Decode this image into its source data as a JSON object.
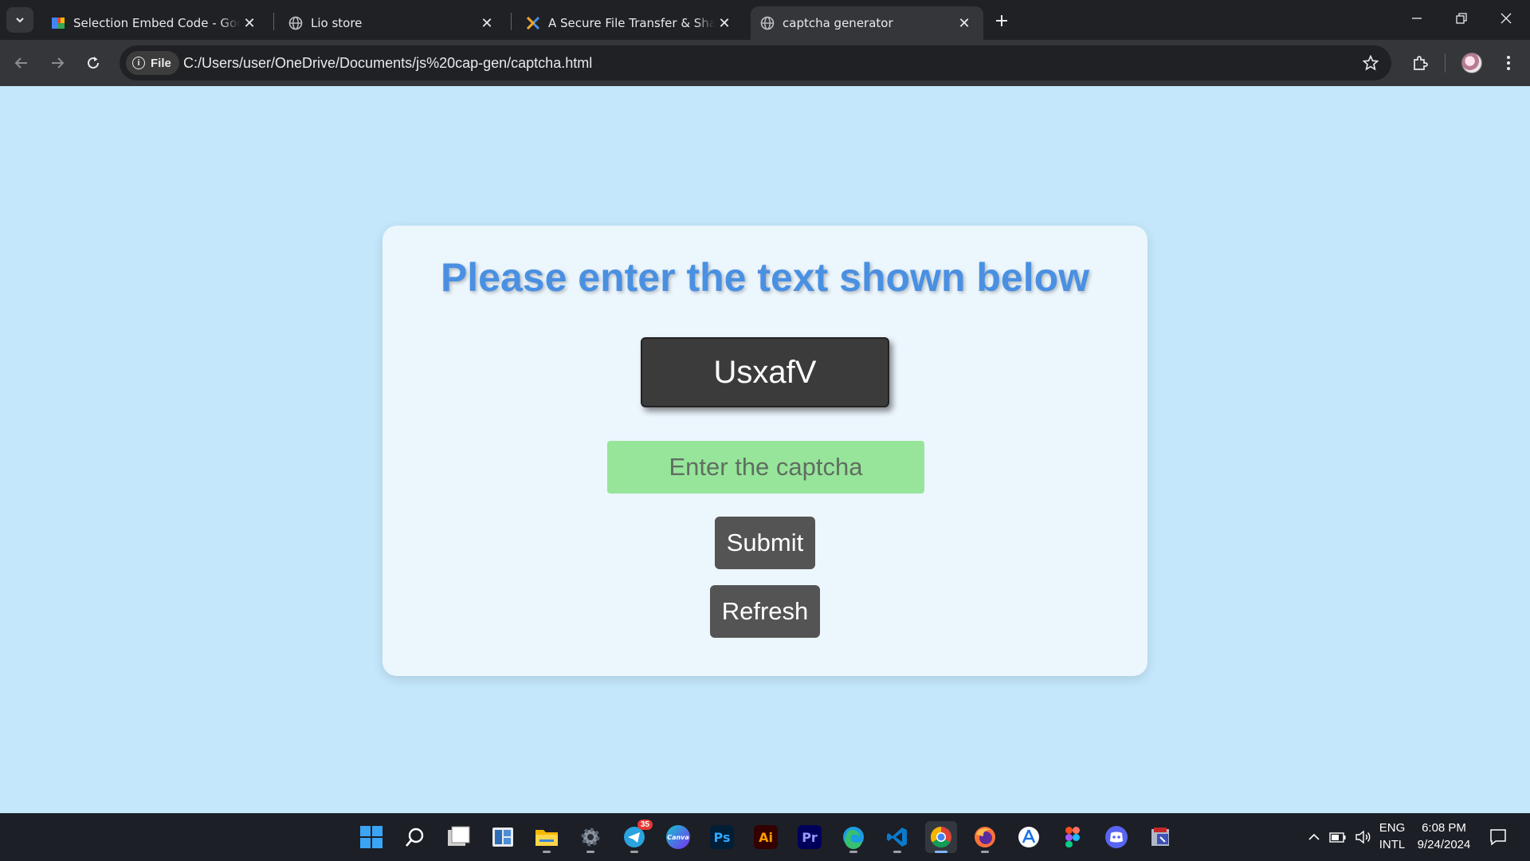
{
  "browser": {
    "tabs": [
      {
        "title": "Selection Embed Code - Google",
        "active": false
      },
      {
        "title": "Lio store",
        "active": false
      },
      {
        "title": "A Secure File Transfer & Share A",
        "active": false
      },
      {
        "title": "captcha generator",
        "active": true
      }
    ],
    "address": {
      "chip_label": "File",
      "url": "C:/Users/user/OneDrive/Documents/js%20cap-gen/captcha.html"
    }
  },
  "page": {
    "heading": "Please enter the text shown below",
    "captcha_text": "UsxafV",
    "input": {
      "placeholder": "Enter the captcha",
      "value": ""
    },
    "submit_label": "Submit",
    "refresh_label": "Refresh",
    "colors": {
      "background": "#c4e7fb",
      "card": "#ecf6fd",
      "heading": "#4a90e2",
      "captcha_box": "#3b3b3b",
      "input": "#97e59a",
      "button": "#545454"
    }
  },
  "taskbar": {
    "apps": [
      "windows-start",
      "search",
      "task-view",
      "widgets",
      "file-explorer",
      "settings",
      "telegram",
      "canva",
      "photoshop",
      "illustrator",
      "premiere-pro",
      "edge",
      "vs-code",
      "chrome",
      "firefox",
      "app-store",
      "figma",
      "discord",
      "archive-app"
    ],
    "labels": {
      "canva": "Canva",
      "photoshop": "Ps",
      "illustrator": "Ai",
      "premiere": "Pr"
    },
    "telegram_badge": "35",
    "language": {
      "line1": "ENG",
      "line2": "INTL"
    },
    "clock": {
      "time": "6:08 PM",
      "date": "9/24/2024"
    }
  }
}
